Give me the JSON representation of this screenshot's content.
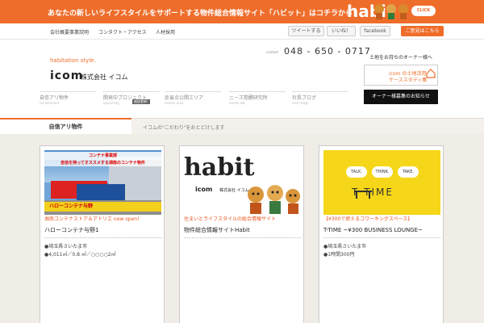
{
  "banner": {
    "text": "あなたの新しいライフスタイルをサポートする物件総合情報サイト「ハビット」はコチラから！",
    "logo": "habit",
    "click": "CLICK"
  },
  "gnav": {
    "links": [
      "会社概要",
      "事業説明",
      "コンタクト・アクセス",
      "人材採用"
    ],
    "tweet": "ツイートする",
    "like": "いいね！",
    "facebook": "facebook",
    "request": "ご意見はこちら"
  },
  "header": {
    "tagline": "habitation style.",
    "logo": "icom",
    "company": "株式会社 イコム",
    "contact_label": "contact",
    "phone": "048 - 650 - 0717"
  },
  "subnav": [
    {
      "label": "自信アリ物件",
      "sub": "recommend",
      "badge": ""
    },
    {
      "label": "開発中プロジェクト",
      "sub": "upcoming",
      "badge": "施設更新!"
    },
    {
      "label": "反省点公開エリア",
      "sub": "review area",
      "badge": ""
    },
    {
      "label": "ニーズ覚醒研究所",
      "sub": "needs lab",
      "badge": ""
    },
    {
      "label": "社長ブログ",
      "sub": "icom blog",
      "badge": ""
    }
  ],
  "side": {
    "title": "土地をお持ちのオーナー様へ",
    "case_line1": "icom の土地活用",
    "case_line2": "ケーススタディ集",
    "owner_button": "オーナー様募集のお知らせ"
  },
  "section": {
    "tab": "自信アリ物件",
    "desc": "イコムの\"こだわり\"をおとどけします"
  },
  "cards": [
    {
      "image_sign1": "コンテナ事業部",
      "image_sign2": "自信を持ってオススメする湘南のコンテナ物件",
      "image_banner": "ハローコンテナ与野",
      "category": "湘南コンテナストア＆アトリエ new open!",
      "title": "ハローコンテナ与野1",
      "lines": [
        "●埼玉県さいたま市",
        "●4,011㎡／0.8 ㎡／○○○○2㎡"
      ],
      "para": []
    },
    {
      "image_logo": "habit",
      "image_icom": "icom",
      "image_company": "株式会社 イコム",
      "category": "住まいとライフスタイルの総合情報サイト",
      "title": "物件総合情報サイトHabit",
      "lines": [],
      "para": []
    },
    {
      "image_bubbles": [
        "TALK.",
        "THINK.",
        "TAKE."
      ],
      "image_logo": "T  TIME",
      "category": "【¥300で使えるコワーキングスペース】",
      "title": "T-TIME ~¥300 BUSINESS LOUNGE~",
      "lines": [
        "●埼玉県さいたま市",
        "●1時間300円"
      ],
      "para": []
    }
  ]
}
